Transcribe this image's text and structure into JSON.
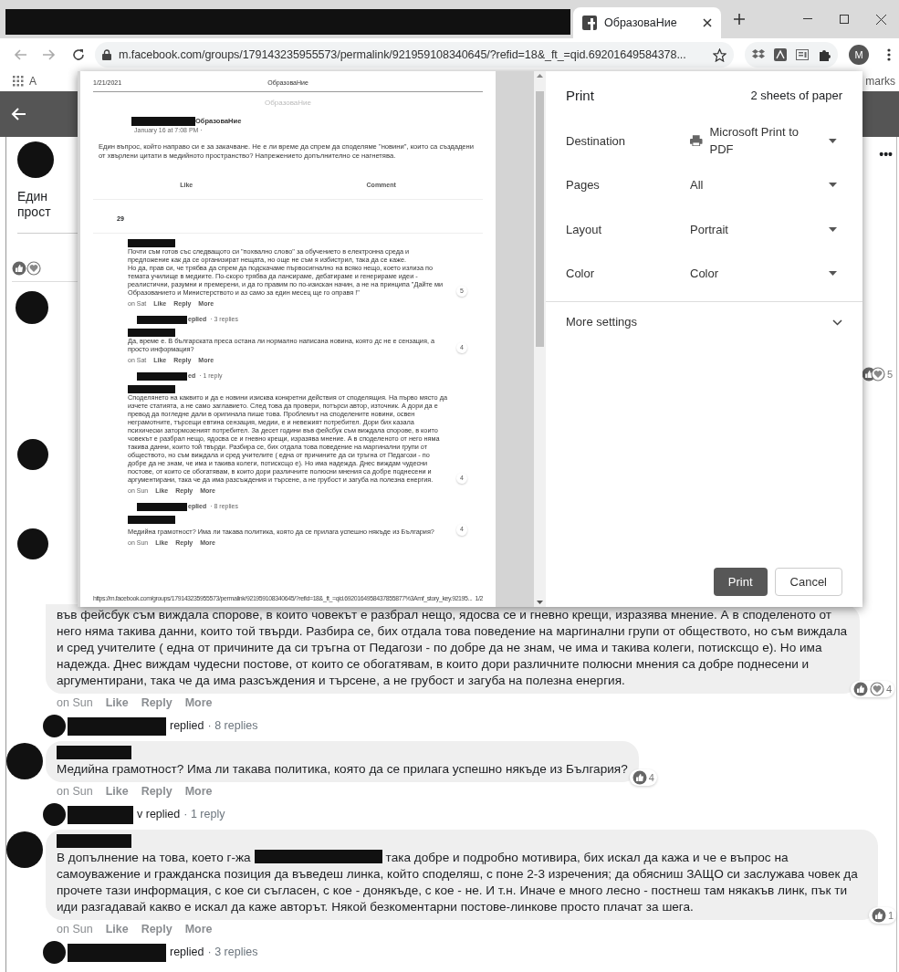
{
  "browser": {
    "tab_title": "ОбразоваНие",
    "address": "m.facebook.com/groups/179143235955573/permalink/921959108340645/?refid=18&_ft_=qid.69201649584378...",
    "profile": "M",
    "bookmark_left": "A",
    "bookmark_right": "marks"
  },
  "page": {
    "side_texts": [
      "Един",
      "прост"
    ],
    "more": "•••",
    "side_reactions": [
      {
        "kind": "like"
      },
      {
        "kind": "love"
      }
    ],
    "side_reaction_count": "5"
  },
  "print_preview": {
    "header_date": "1/21/2021",
    "header_title": "ОбразоваНие",
    "site_title": "ОбразоваНие",
    "post": {
      "group": "ОбразоваНие",
      "time": "January 16 at 7:08 PM ·",
      "text": "Един въпрос, който направо си е за закачване. Не е ли време да спрем да споделяме \"новини\", които са създадени от хвърлени цитати в медийното пространство? Напрежението допълнително се нагнетява.",
      "actions": [
        "Like",
        "Comment"
      ],
      "count": "29"
    },
    "comments": [
      {
        "text": "Почти съм готов със следващото си \"похвално слово\" за обучението в електронна среда и предложение как да се организират нещата, но още не съм я избистрил, така да се каже.\nНо да, прав си, че трябва да спрем да подскачаме първосигнално на всяко нещо, което излиза по темата училище в медиите. По-скоро трябва да лансираме, дебатираме и генерираме идеи - реалистични, разумни и премерени, и да го правим по по-изискан начин, а не на принципа \"Дайте ми Образованието и Министерството и аз само за един месец ще го оправя !\"",
        "reaction_count": "5",
        "meta": [
          "on Sat",
          "Like",
          "Reply",
          "More"
        ],
        "reply_line": {
          "label": "eplied",
          "count": "· 3 replies"
        }
      },
      {
        "text": "Да, време е. В българската преса остана ли нормално написана новина, която дс не е сензация, а просто информация?",
        "reaction_count": "4",
        "meta": [
          "on Sat",
          "Like",
          "Reply",
          "More"
        ],
        "reply_line": {
          "label": "ed",
          "count": "· 1 reply"
        }
      },
      {
        "text": "Споделянето на каквито и да е новини изисква конкретни действия от споделящия. На първо място да изчете статията, а не само заглавието. След това да провери, потърси автор, източник. А дори да е превод да погледне дали в оригинала пише това. Проблемът на споделените новини, освен неграмотните, търсещи евтина сензация, медии, е и невежият потребител. Дори бих казала психически затормозеният потребител. За десет години във фейсбук съм виждала спорове, в които човекът е разбрал нещо, ядосва се и гневно крещи, изразява мнение. А в споделеното от него няма такива данни, които той твърди. Разбира се, бих отдала това поведение на маргинални групи от обществото, но съм виждала и сред учителите ( една от причините да си тръгна от Педагози - по добре да не знам, че има и такива колеги, потисксщо е). Но има надежда. Днес виждам чудесни постове, от които се обогатявам, в които дори различните полюсни мнения са добре поднесени и аргументирани, така че да има разсъждения и търсене, а не грубост и загуба на полезна енергия.",
        "reaction_count": "4",
        "meta": [
          "on Sun",
          "Like",
          "Reply",
          "More"
        ],
        "reply_line": {
          "label": "eplied",
          "count": "· 8 replies"
        }
      },
      {
        "text": "Медийна грамотност? Има ли такава политика, която да се прилага успешно някъде из България?",
        "reaction_count": "4",
        "meta": [
          "on Sun",
          "Like",
          "Reply",
          "More"
        ]
      }
    ],
    "footer_url": "https://m.facebook.com/groups/179143235955573/permalink/921959108340645/?refid=18&_ft_=qid.6920164958437855877%3Amf_story_key.92195...",
    "footer_page": "1/2"
  },
  "print_settings": {
    "title": "Print",
    "sheets": "2 sheets of paper",
    "rows": [
      {
        "label": "Destination",
        "value": "Microsoft Print to PDF",
        "kind": "printer"
      },
      {
        "label": "Pages",
        "value": "All",
        "kind": "plain"
      },
      {
        "label": "Layout",
        "value": "Portrait",
        "kind": "plain"
      },
      {
        "label": "Color",
        "value": "Color",
        "kind": "plain"
      }
    ],
    "more_settings": "More settings",
    "buttons": [
      "Print",
      "Cancel"
    ]
  },
  "comments": [
    {
      "kind": "continued",
      "text_parts": [
        "във фейсбук съм виждала спорове, в които човекът е разбрал нещо, ядосва се и гневно крещи, изразява мнение. А в споделеното от него няма такива данни, които той твърди. Разбира се, бих отдала това поведение на маргинални групи от обществото, но съм виждала и сред учителите ( една от причините да си тръгна от Педагози - по добре да не знам, че има и такива колеги, потисксщо е). Но има надежда. Днес виждам чудесни постове, от които се обогатявам, в които дори различните полюсни мнения са добре поднесени и аргументирани, така че да има разсъждения и търсене, а не грубост и загуба на полезна енергия."
      ],
      "reactions": [
        {
          "kind": "like"
        },
        {
          "kind": "love"
        }
      ],
      "reaction_count": "4",
      "meta": [
        "on Sun",
        "Like",
        "Reply",
        "More"
      ],
      "reply_line": {
        "label": "replied",
        "count": "· 8 replies"
      }
    },
    {
      "kind": "full",
      "text_parts": [
        "Медийна грамотност? Има ли такава политика, която да се прилага успешно някъде из България?"
      ],
      "reactions": [
        {
          "kind": "like"
        }
      ],
      "reaction_count": "4",
      "meta": [
        "on Sun",
        "Like",
        "Reply",
        "More"
      ],
      "reply_line": {
        "label": "v replied",
        "count": "· 1 reply"
      }
    },
    {
      "kind": "full",
      "text_parts": [
        "В допълнение на това, което г-жа",
        "така добре и подробно мотивира, бих искал да кажа и че е въпрос на самоуважение и гражданска позиция да въведеш линка, който споделяш, с поне 2-3 изречения; да обясниш ЗАЩО си заслужава човек да прочете тази информация, с кое си съгласен, с кое - донякъде, с кое - не. И т.н. Иначе е много лесно - постнеш там някакъв линк, пък ти иди разгадавай какво е искал да каже авторът. Някой безкоментарни постове-линкове просто плачат за шега."
      ],
      "reactions": [
        {
          "kind": "like"
        }
      ],
      "reaction_count": "1",
      "meta": [
        "on Sun",
        "Like",
        "Reply",
        "More"
      ],
      "reply_line": {
        "label": "replied",
        "count": "· 3 replies"
      }
    }
  ]
}
